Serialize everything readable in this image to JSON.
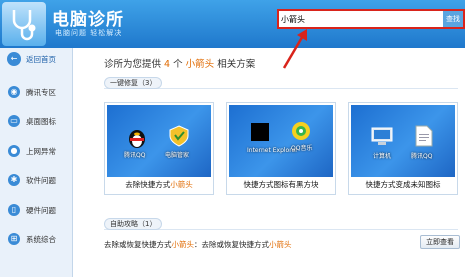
{
  "header": {
    "title": "电脑诊所",
    "subtitle": "电脑问题 轻松解决",
    "search_value": "小箭头",
    "search_button": "查找"
  },
  "sidebar": {
    "items": [
      {
        "label": "返回首页",
        "icon": "back-arrow-icon"
      },
      {
        "label": "腾讯专区",
        "icon": "bell-icon"
      },
      {
        "label": "桌面图标",
        "icon": "monitor-icon"
      },
      {
        "label": "上网异常",
        "icon": "globe-icon"
      },
      {
        "label": "软件问题",
        "icon": "puzzle-icon"
      },
      {
        "label": "硬件问题",
        "icon": "hardware-icon"
      },
      {
        "label": "系统综合",
        "icon": "windows-icon"
      }
    ]
  },
  "main": {
    "intro": {
      "prefix": "诊所为您提供",
      "count": "4",
      "mid": "个",
      "keyword": "小箭头",
      "suffix": "相关方案"
    },
    "section1": "一键修复（3）",
    "cards": [
      {
        "caption_prefix": "去除快捷方式",
        "caption_keyword": "小箭头",
        "caption_suffix": "",
        "icons": [
          "腾讯QQ",
          "电脑管家"
        ]
      },
      {
        "caption_prefix": "快捷方式图标有黑方块",
        "caption_keyword": "",
        "caption_suffix": "",
        "icons": [
          "Internet Explorer",
          "QQ音乐"
        ]
      },
      {
        "caption_prefix": "快捷方式变成未知图标",
        "caption_keyword": "",
        "caption_suffix": "",
        "icons": [
          "计算机",
          "腾讯QQ"
        ]
      }
    ],
    "section2": "自助攻略（1）",
    "guide": {
      "prefix": "去除或恢复快捷方式",
      "kw1": "小箭头",
      "mid": "：去除或恢复快捷方式",
      "kw2": "小箭头"
    },
    "view_button": "立即查看"
  },
  "colors": {
    "accent": "#1f78cc",
    "keyword": "#e06a00",
    "search_border": "#d9241b"
  }
}
